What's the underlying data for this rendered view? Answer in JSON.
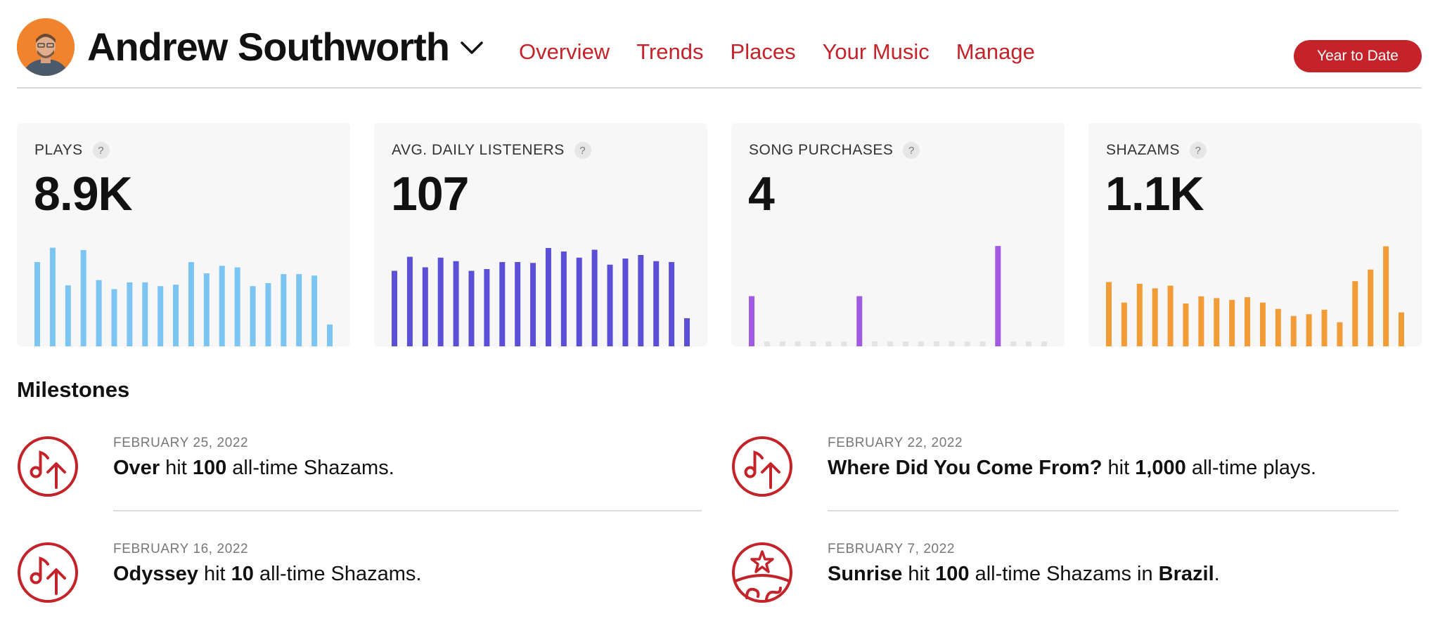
{
  "header": {
    "user_name": "Andrew Southworth",
    "nav": [
      "Overview",
      "Trends",
      "Places",
      "Your Music",
      "Manage"
    ],
    "range_button": "Year to Date"
  },
  "colors": {
    "accent": "#c4232a",
    "plays": "#7cc4f2",
    "listeners": "#5a4fd6",
    "purchases": "#a05be0",
    "shazams": "#f29c38",
    "empty": "#e3e3e3"
  },
  "stats": [
    {
      "label": "PLAYS",
      "help": "?",
      "value": "8.9K"
    },
    {
      "label": "AVG. DAILY LISTENERS",
      "help": "?",
      "value": "107"
    },
    {
      "label": "SONG PURCHASES",
      "help": "?",
      "value": "4"
    },
    {
      "label": "SHAZAMS",
      "help": "?",
      "value": "1.1K"
    }
  ],
  "chart_data": [
    {
      "type": "bar",
      "series": [
        {
          "values": [
            112,
            131,
            81,
            128,
            88,
            76,
            85,
            85,
            80,
            82,
            112,
            97,
            107,
            105,
            80,
            84,
            96,
            96,
            94,
            29
          ]
        }
      ]
    },
    {
      "type": "bar",
      "series": [
        {
          "values": [
            86,
            102,
            90,
            101,
            97,
            86,
            88,
            96,
            96,
            95,
            112,
            108,
            101,
            110,
            93,
            100,
            104,
            97,
            96,
            32
          ]
        }
      ]
    },
    {
      "type": "bar",
      "series": [
        {
          "values": [
            1,
            0,
            0,
            0,
            0,
            0,
            0,
            1,
            0,
            0,
            0,
            0,
            0,
            0,
            0,
            0,
            2,
            0,
            0,
            0
          ]
        }
      ]
    },
    {
      "type": "bar",
      "series": [
        {
          "values": [
            72,
            49,
            70,
            65,
            68,
            48,
            56,
            54,
            52,
            55,
            49,
            42,
            34,
            36,
            41,
            27,
            73,
            86,
            112,
            38
          ]
        }
      ]
    }
  ],
  "milestones": {
    "title": "Milestones",
    "items": [
      {
        "date": "FEBRUARY 25, 2022",
        "song": "Over",
        "mid": " hit ",
        "count": "100",
        "tail": " all-time Shazams.",
        "icon": "music-note-up-icon"
      },
      {
        "date": "FEBRUARY 22, 2022",
        "song": "Where Did You Come From?",
        "mid": " hit ",
        "count": "1,000",
        "tail": " all-time plays.",
        "icon": "music-note-up-icon"
      },
      {
        "date": "FEBRUARY 16, 2022",
        "song": "Odyssey",
        "mid": " hit ",
        "count": "10",
        "tail": " all-time Shazams.",
        "icon": "music-note-up-icon"
      },
      {
        "date": "FEBRUARY 7, 2022",
        "song": "Sunrise",
        "mid": " hit ",
        "count": "100",
        "tail": " all-time Shazams in ",
        "place": "Brazil",
        "end": ".",
        "icon": "globe-star-icon"
      }
    ]
  }
}
